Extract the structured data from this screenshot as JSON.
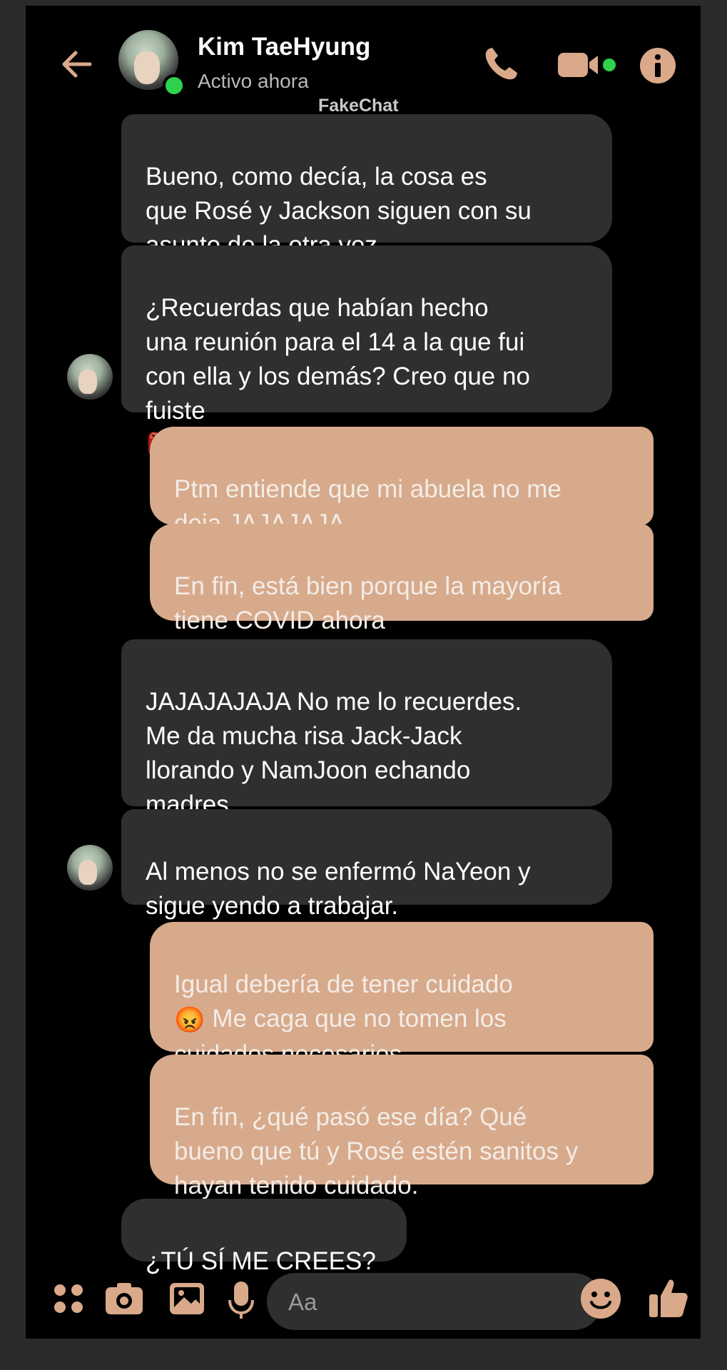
{
  "header": {
    "contact_name": "Kim TaeHyung",
    "status": "Activo ahora",
    "watermark": "FakeChat"
  },
  "messages": [
    {
      "side": "in",
      "text": "Bueno, como decía, la cosa es\nque Rosé y Jackson siguen con su\nasunto de la otra vez."
    },
    {
      "side": "in",
      "text": "¿Recuerdas que habían hecho\nuna reunión para el 14 a la que fui\ncon ella y los demás? Creo que no\nfuiste",
      "emoji": "👺"
    },
    {
      "side": "out",
      "text": "Ptm entiende que mi abuela no me\ndeja JAJAJAJA"
    },
    {
      "side": "out",
      "text": "En fin, está bien porque la mayoría\ntiene COVID ahora",
      "emoji": "🤡🤡"
    },
    {
      "side": "in",
      "text": "JAJAJAJAJA No me lo recuerdes.\nMe da mucha risa Jack-Jack\nllorando y NamJoon echando\nmadres"
    },
    {
      "side": "in",
      "text": "Al menos no se enfermó NaYeon y\nsigue yendo a trabajar."
    },
    {
      "side": "out",
      "emoji_lead": "😡",
      "text_before": "Igual debería de tener cuidado\n",
      "text": " Me caga que no tomen los\ncuidados necesarios."
    },
    {
      "side": "out",
      "text": "En fin, ¿qué pasó ese día? Qué\nbueno que tú y Rosé estén sanitos y\nhayan tenido cuidado."
    },
    {
      "side": "in",
      "text": "¿TÚ SÍ ME CREES?"
    }
  ],
  "composer": {
    "placeholder": "Aa"
  },
  "colors": {
    "background": "#000000",
    "incoming_bubble": "#2f2f2f",
    "outgoing_bubble": "#d7aa8c",
    "accent": "#d9a98a",
    "online": "#2fd14d"
  },
  "icons": [
    "back-arrow-icon",
    "phone-icon",
    "video-camera-icon",
    "info-icon",
    "apps-icon",
    "camera-icon",
    "image-icon",
    "microphone-icon",
    "smiley-icon",
    "thumbs-up-icon"
  ]
}
